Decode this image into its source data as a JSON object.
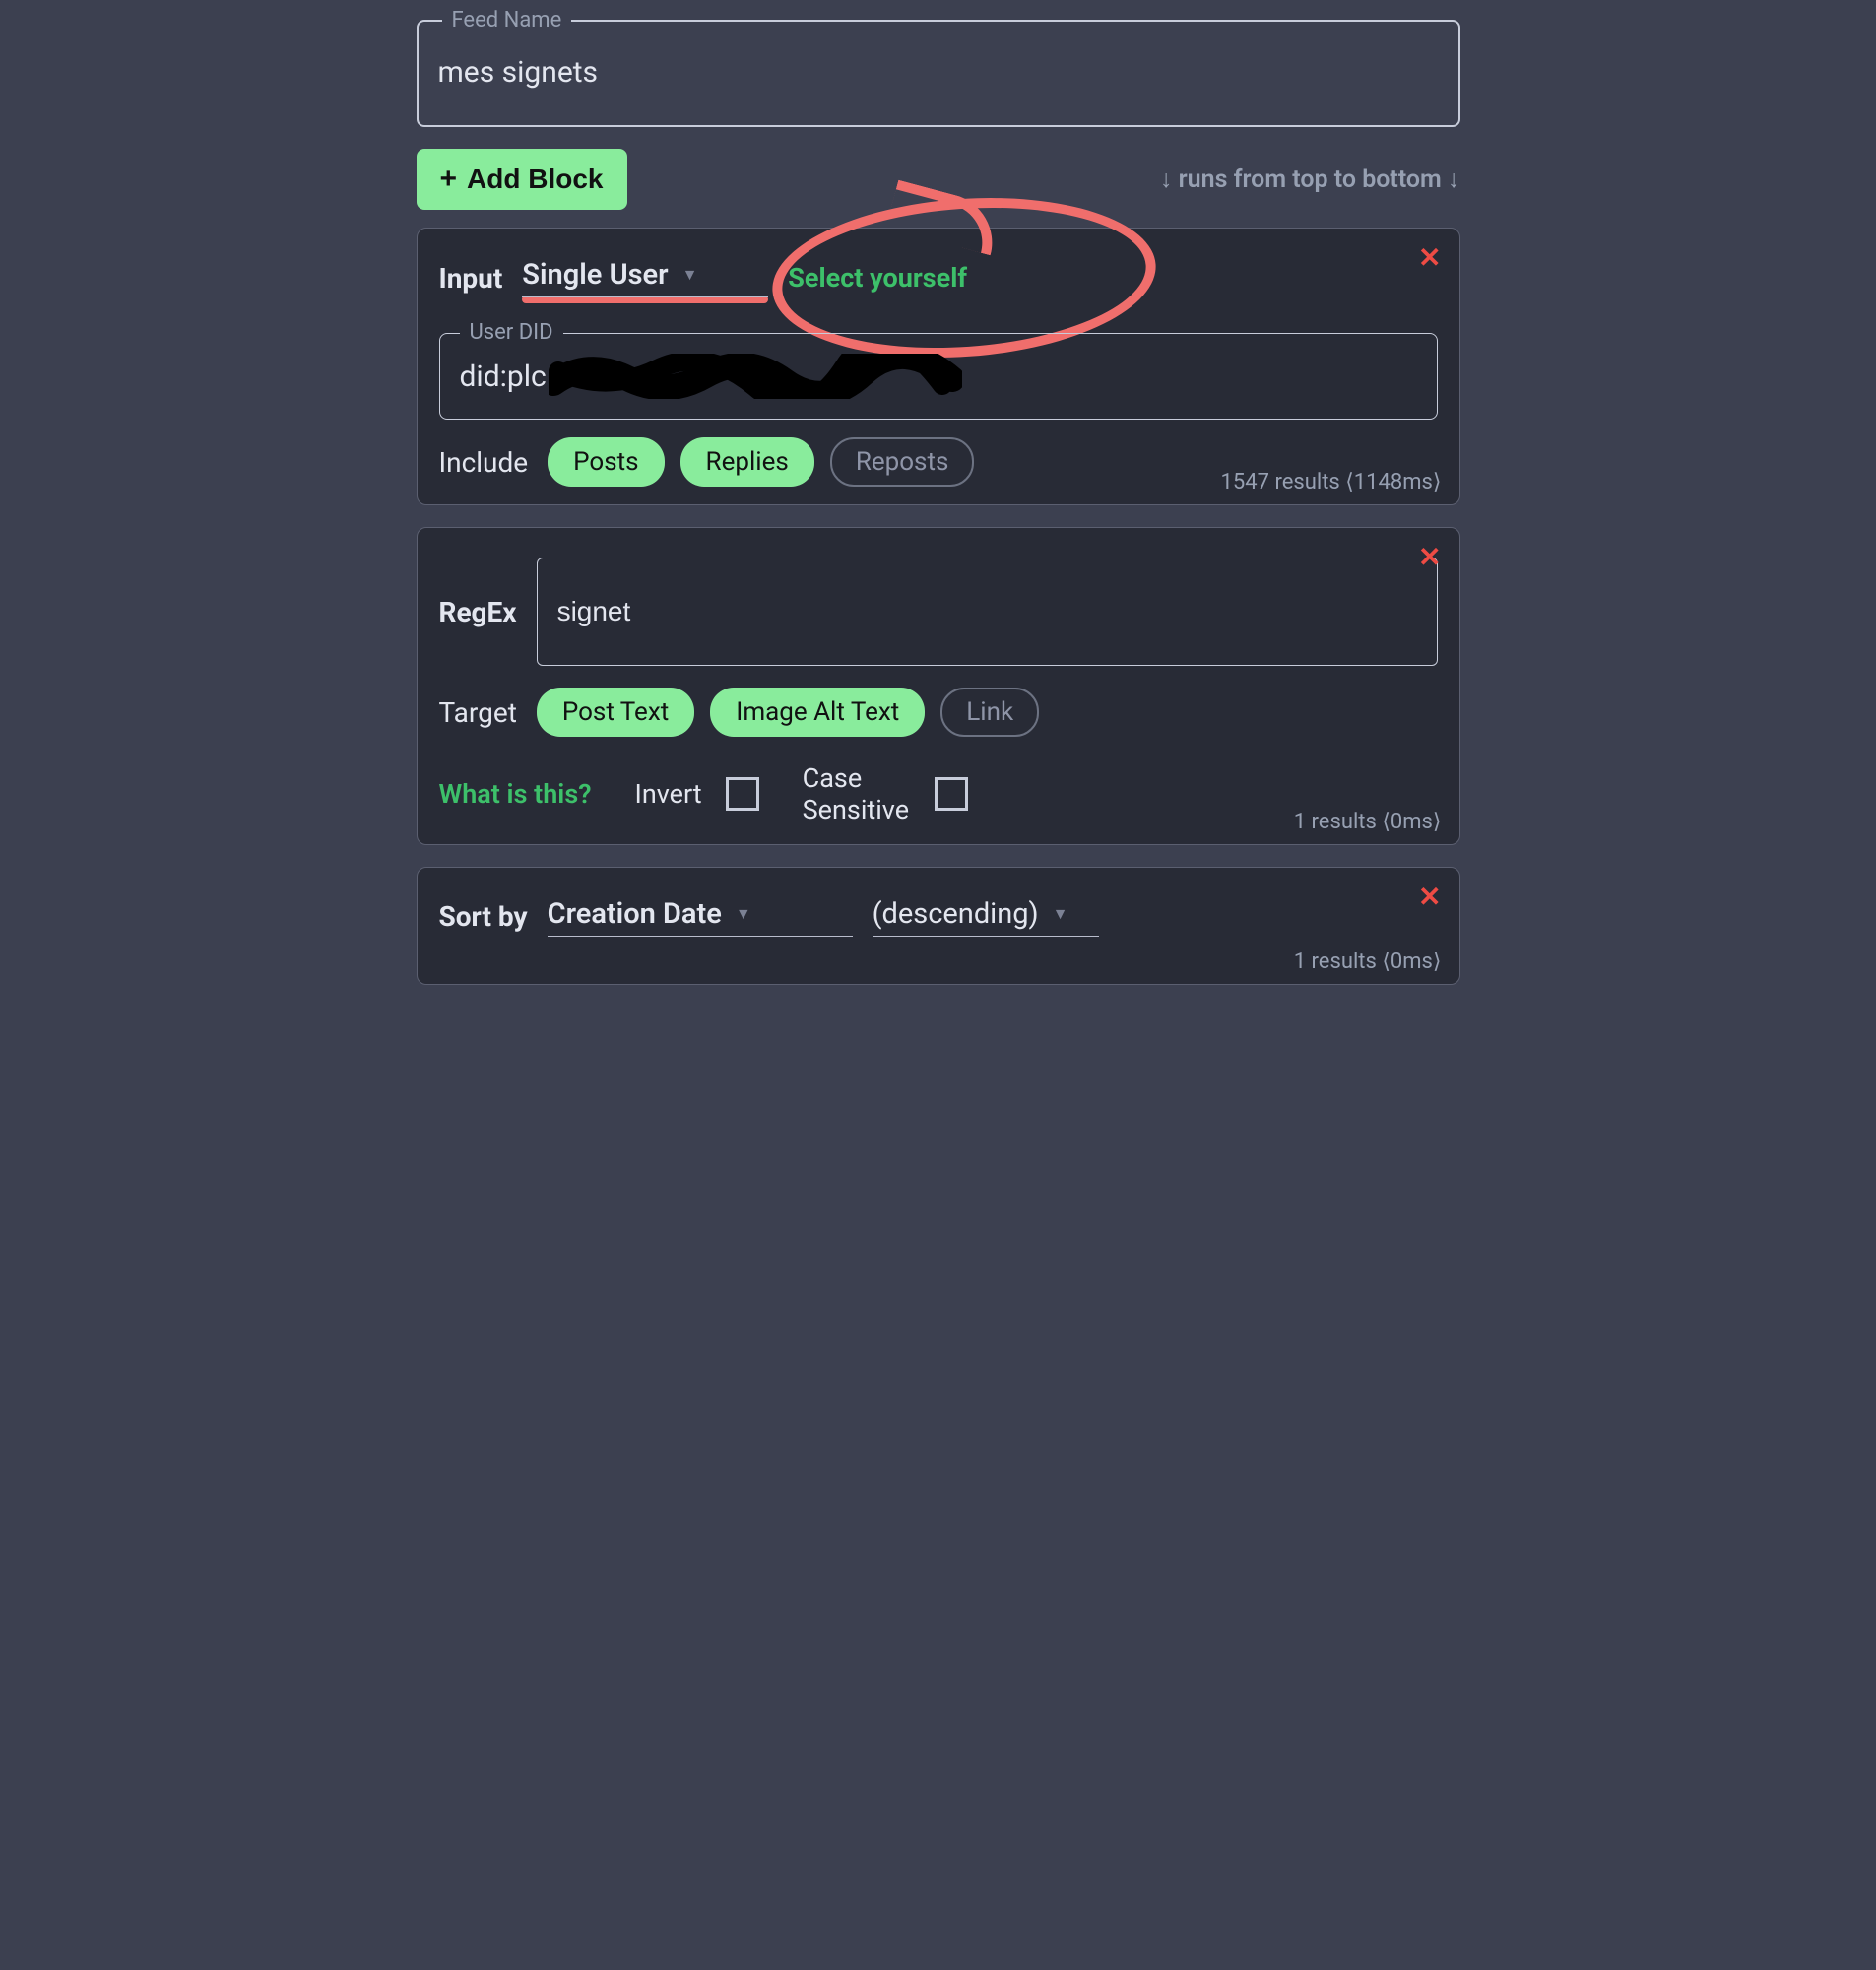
{
  "feed": {
    "legend": "Feed Name",
    "value": "mes signets"
  },
  "toolbar": {
    "add_block": "Add Block",
    "hint": "↓ runs from top to bottom ↓"
  },
  "blocks": {
    "input": {
      "label": "Input",
      "type": "Single User",
      "select_yourself": "Select yourself",
      "did_legend": "User DID",
      "did_value": "did:plc",
      "include_label": "Include",
      "chips": {
        "posts": "Posts",
        "replies": "Replies",
        "reposts": "Reposts"
      },
      "results": "1547 results ⟨1148ms⟩"
    },
    "regex": {
      "label": "RegEx",
      "value": "signet",
      "target_label": "Target",
      "chips": {
        "post_text": "Post Text",
        "alt_text": "Image Alt Text",
        "link": "Link"
      },
      "help": "What is this?",
      "invert": "Invert",
      "case": "Case Sensitive",
      "results": "1 results ⟨0ms⟩"
    },
    "sort": {
      "label": "Sort by",
      "key": "Creation Date",
      "dir": "(descending)",
      "results": "1 results ⟨0ms⟩"
    }
  }
}
